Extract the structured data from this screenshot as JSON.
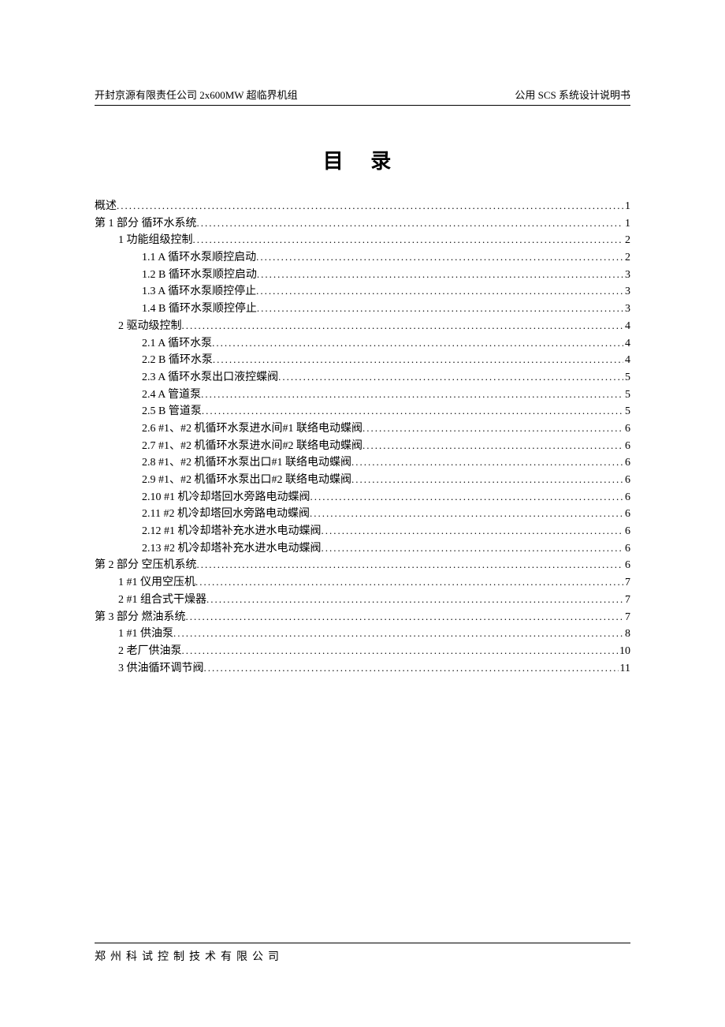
{
  "header": {
    "left": "开封京源有限责任公司 2x600MW 超临界机组",
    "right": "公用 SCS 系统设计说明书"
  },
  "title": "目 录",
  "toc": [
    {
      "indent": 0,
      "label": "概述",
      "page": "1"
    },
    {
      "indent": 0,
      "label": "第 1 部分  循环水系统",
      "page": "1"
    },
    {
      "indent": 1,
      "label": "1 功能组级控制",
      "page": "2"
    },
    {
      "indent": 2,
      "label": "1.1 A 循环水泵顺控启动",
      "page": "2"
    },
    {
      "indent": 2,
      "label": "1.2 B 循环水泵顺控启动",
      "page": "3"
    },
    {
      "indent": 2,
      "label": "1.3 A 循环水泵顺控停止",
      "page": "3"
    },
    {
      "indent": 2,
      "label": "1.4 B 循环水泵顺控停止",
      "page": "3"
    },
    {
      "indent": 1,
      "label": "2 驱动级控制",
      "page": "4"
    },
    {
      "indent": 2,
      "label": "2.1 A 循环水泵",
      "page": "4"
    },
    {
      "indent": 2,
      "label": "2.2 B 循环水泵",
      "page": "4"
    },
    {
      "indent": 2,
      "label": "2.3 A 循环水泵出口液控蝶阀",
      "page": "5"
    },
    {
      "indent": 2,
      "label": "2.4 A 管道泵",
      "page": "5"
    },
    {
      "indent": 2,
      "label": "2.5 B 管道泵",
      "page": "5"
    },
    {
      "indent": 2,
      "label": "2.6 #1、#2 机循环水泵进水间#1 联络电动蝶阀",
      "page": "6"
    },
    {
      "indent": 2,
      "label": "2.7 #1、#2 机循环水泵进水间#2 联络电动蝶阀",
      "page": "6"
    },
    {
      "indent": 2,
      "label": "2.8 #1、#2 机循环水泵出口#1 联络电动蝶阀",
      "page": "6"
    },
    {
      "indent": 2,
      "label": "2.9 #1、#2 机循环水泵出口#2 联络电动蝶阀",
      "page": "6"
    },
    {
      "indent": 2,
      "label": "2.10 #1 机冷却塔回水旁路电动蝶阀",
      "page": "6"
    },
    {
      "indent": 2,
      "label": "2.11 #2 机冷却塔回水旁路电动蝶阀",
      "page": "6"
    },
    {
      "indent": 2,
      "label": "2.12 #1 机冷却塔补充水进水电动蝶阀",
      "page": "6"
    },
    {
      "indent": 2,
      "label": "2.13 #2 机冷却塔补充水进水电动蝶阀",
      "page": "6"
    },
    {
      "indent": 0,
      "label": "第 2 部分  空压机系统",
      "page": "6"
    },
    {
      "indent": 1,
      "label": "1 #1 仪用空压机",
      "page": "7"
    },
    {
      "indent": 1,
      "label": "2 #1 组合式干燥器",
      "page": "7"
    },
    {
      "indent": 0,
      "label": "第 3 部分  燃油系统",
      "page": "7"
    },
    {
      "indent": 1,
      "label": "1 #1 供油泵",
      "page": "8"
    },
    {
      "indent": 1,
      "label": "2 老厂供油泵",
      "page": "10"
    },
    {
      "indent": 1,
      "label": "3 供油循环调节阀",
      "page": "11"
    }
  ],
  "footer": "郑州科试控制技术有限公司"
}
